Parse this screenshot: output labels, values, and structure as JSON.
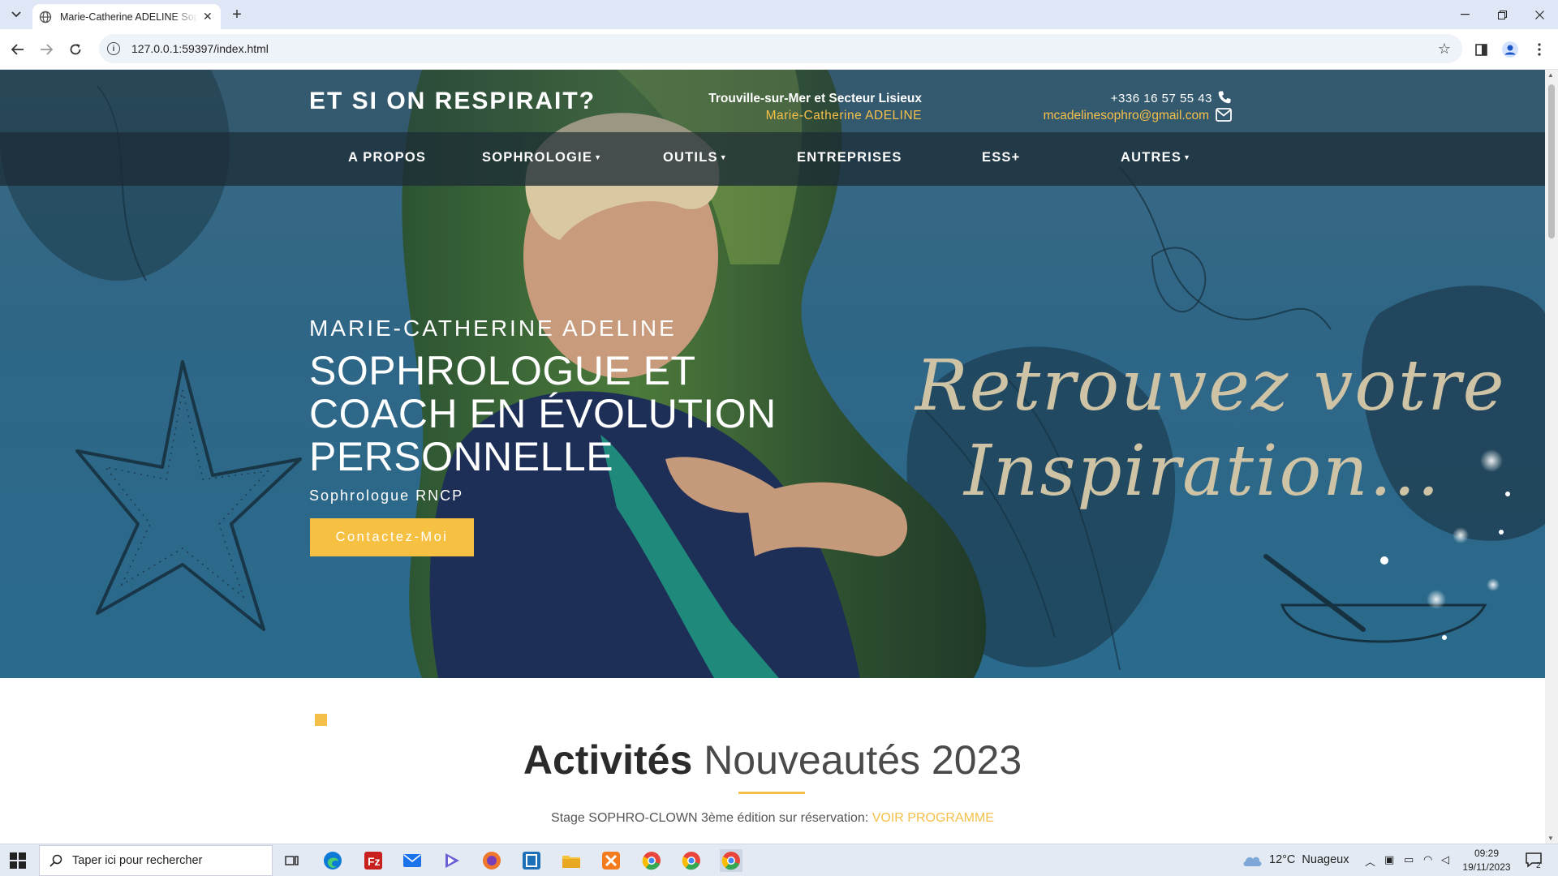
{
  "browser": {
    "tab_title": "Marie-Catherine ADELINE Sophrologue",
    "url": "127.0.0.1:59397/index.html"
  },
  "site": {
    "brand": "ET SI ON RESPIRAIT?",
    "location": "Trouville-sur-Mer et Secteur Lisieux",
    "owner": "Marie-Catherine ADELINE",
    "phone": "+336 16 57 55 43",
    "email": "mcadelinesophro@gmail.com",
    "nav": [
      {
        "label": "A PROPOS",
        "dropdown": false
      },
      {
        "label": "SOPHROLOGIE",
        "dropdown": true
      },
      {
        "label": "OUTILS",
        "dropdown": true
      },
      {
        "label": "ENTREPRISES",
        "dropdown": false
      },
      {
        "label": "ESS+",
        "dropdown": false
      },
      {
        "label": "AUTRES",
        "dropdown": true
      }
    ],
    "hero": {
      "eyebrow": "MARIE-CATHERINE ADELINE",
      "title_lines": [
        "SOPHROLOGUE ET",
        "COACH EN ÉVOLUTION",
        "PERSONNELLE"
      ],
      "subtitle": "Sophrologue RNCP",
      "cta": "Contactez-Moi",
      "script_line1": "Retrouvez votre",
      "script_line2": "Inspiration..."
    },
    "section": {
      "title_bold": "Activités",
      "title_light": "Nouveautés 2023",
      "announcement": "Stage SOPHRO-CLOWN 3ème édition sur réservation:",
      "announcement_link": "VOIR PROGRAMME"
    }
  },
  "taskbar": {
    "search_placeholder": "Taper ici pour rechercher",
    "weather_temp": "12°C",
    "weather_desc": "Nuageux",
    "time": "09:29",
    "date": "19/11/2023",
    "notification_count": "2"
  },
  "colors": {
    "accent": "#f5c04a",
    "hero_blue": "#2f6686",
    "nav_dark": "#1c2c36"
  }
}
